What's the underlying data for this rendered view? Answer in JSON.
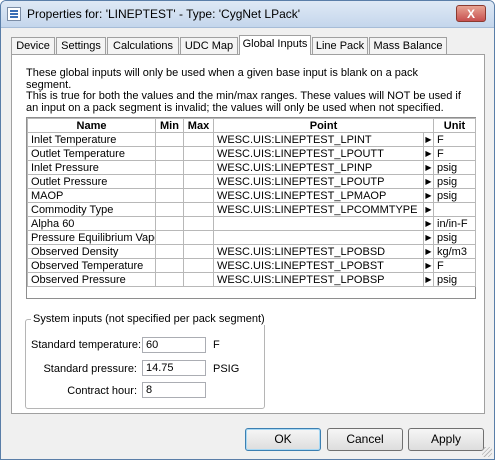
{
  "window": {
    "title": "Properties for: 'LINEPTEST' - Type: 'CygNet LPack'",
    "close_glyph": "X"
  },
  "tabs": [
    {
      "label": "Device"
    },
    {
      "label": "Settings"
    },
    {
      "label": "Calculations"
    },
    {
      "label": "UDC Map"
    },
    {
      "label": "Global Inputs",
      "active": true
    },
    {
      "label": "Line Pack"
    },
    {
      "label": "Mass Balance"
    }
  ],
  "description": [
    "These global inputs will only be used when a given base input is blank on a pack segment.",
    "This is true for both the values and the min/max ranges. These values will NOT be used if",
    "an input on a pack segment is invalid; the values will only be used when not specified."
  ],
  "grid": {
    "headers": {
      "name": "Name",
      "min": "Min",
      "max": "Max",
      "point": "Point",
      "unit": "Unit"
    },
    "arrow_glyph": "▶",
    "rows": [
      {
        "name": "Inlet Temperature",
        "min": "",
        "max": "",
        "point": "WESC.UIS:LINEPTEST_LPINT",
        "unit": "F"
      },
      {
        "name": "Outlet Temperature",
        "min": "",
        "max": "",
        "point": "WESC.UIS:LINEPTEST_LPOUTT",
        "unit": "F"
      },
      {
        "name": "Inlet Pressure",
        "min": "",
        "max": "",
        "point": "WESC.UIS:LINEPTEST_LPINP",
        "unit": "psig"
      },
      {
        "name": "Outlet Pressure",
        "min": "",
        "max": "",
        "point": "WESC.UIS:LINEPTEST_LPOUTP",
        "unit": "psig"
      },
      {
        "name": "MAOP",
        "min": "",
        "max": "",
        "point": "WESC.UIS:LINEPTEST_LPMAOP",
        "unit": "psig"
      },
      {
        "name": "Commodity Type",
        "min": "",
        "max": "",
        "point": "WESC.UIS:LINEPTEST_LPCOMMTYPE",
        "unit": ""
      },
      {
        "name": "Alpha 60",
        "min": "",
        "max": "",
        "point": "",
        "unit": "in/in-F"
      },
      {
        "name": "Pressure Equilibrium Vapor",
        "min": "",
        "max": "",
        "point": "",
        "unit": "psig"
      },
      {
        "name": "Observed Density",
        "min": "",
        "max": "",
        "point": "WESC.UIS:LINEPTEST_LPOBSD",
        "unit": "kg/m3"
      },
      {
        "name": "Observed Temperature",
        "min": "",
        "max": "",
        "point": "WESC.UIS:LINEPTEST_LPOBST",
        "unit": "F"
      },
      {
        "name": "Observed Pressure",
        "min": "",
        "max": "",
        "point": "WESC.UIS:LINEPTEST_LPOBSP",
        "unit": "psig"
      }
    ]
  },
  "system_inputs": {
    "title": "System inputs (not specified per pack segment)",
    "standard_temperature": {
      "label": "Standard temperature:",
      "value": "60",
      "unit": "F"
    },
    "standard_pressure": {
      "label": "Standard pressure:",
      "value": "14.75",
      "unit": "PSIG"
    },
    "contract_hour": {
      "label": "Contract hour:",
      "value": "8"
    }
  },
  "buttons": {
    "ok": "OK",
    "cancel": "Cancel",
    "apply": "Apply"
  }
}
